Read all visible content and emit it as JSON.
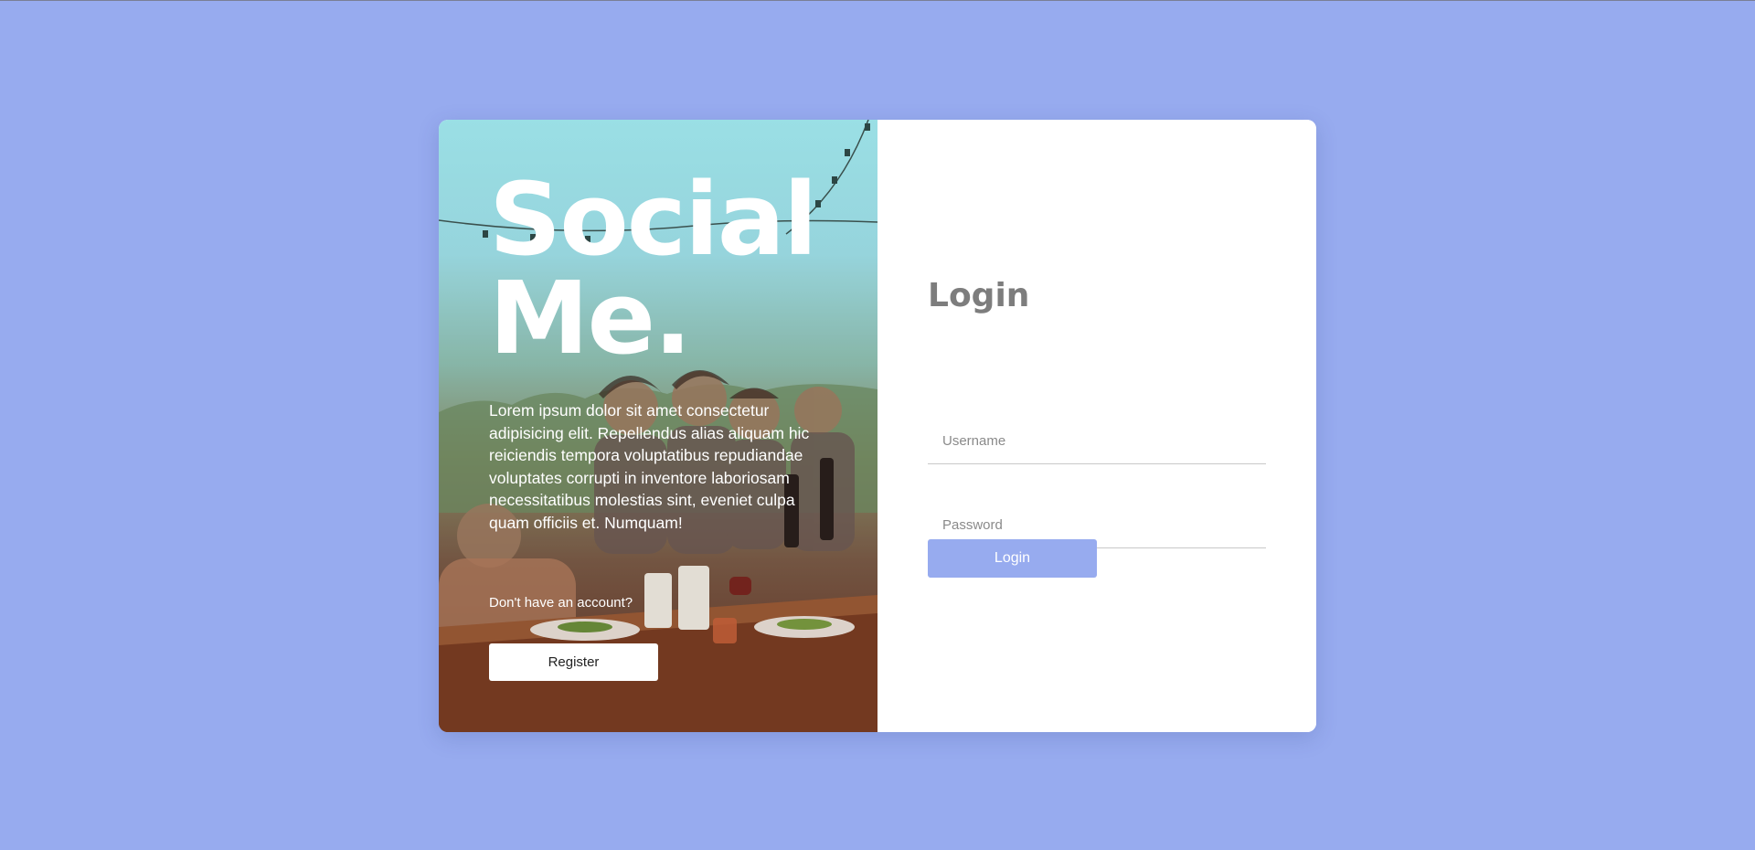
{
  "colors": {
    "page_background": "#97abef",
    "accent": "#97abef",
    "title_gray": "#7d7d7d"
  },
  "left_panel": {
    "brand_title": "Social\nMe.",
    "description": "Lorem ipsum dolor sit amet consectetur adipisicing elit. Repellendus alias aliquam hic reiciendis tempora voluptatibus repudiandae voluptates corrupti in inventore laboriosam necessitatibus molestias sint, eveniet culpa quam officiis et. Numquam!",
    "no_account_text": "Don't have an account?",
    "register_label": "Register",
    "background_image": "photo of friends dining at an outdoor table with string lights"
  },
  "login_form": {
    "title": "Login",
    "username": {
      "value": "",
      "placeholder": "Username"
    },
    "password": {
      "value": "",
      "placeholder": "Password"
    },
    "submit_label": "Login"
  }
}
